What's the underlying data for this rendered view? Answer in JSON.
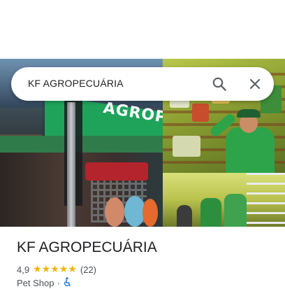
{
  "search": {
    "query": "KF AGROPECUÁRIA"
  },
  "photos": {
    "storefront_sign_text": "AGROPECUÁRIA"
  },
  "place": {
    "name": "KF AGROPECUÁRIA",
    "rating": "4,9",
    "star_count": 5,
    "reviews": "(22)",
    "category": "Pet Shop",
    "separator": "·"
  },
  "icons": {
    "search": "search-icon",
    "close": "close-icon",
    "star": "star-icon",
    "accessibility": "wheelchair-icon"
  },
  "colors": {
    "star": "#f5b400",
    "accessibility": "#1a73e8",
    "title": "#202124",
    "secondary_text": "#4d5156"
  }
}
